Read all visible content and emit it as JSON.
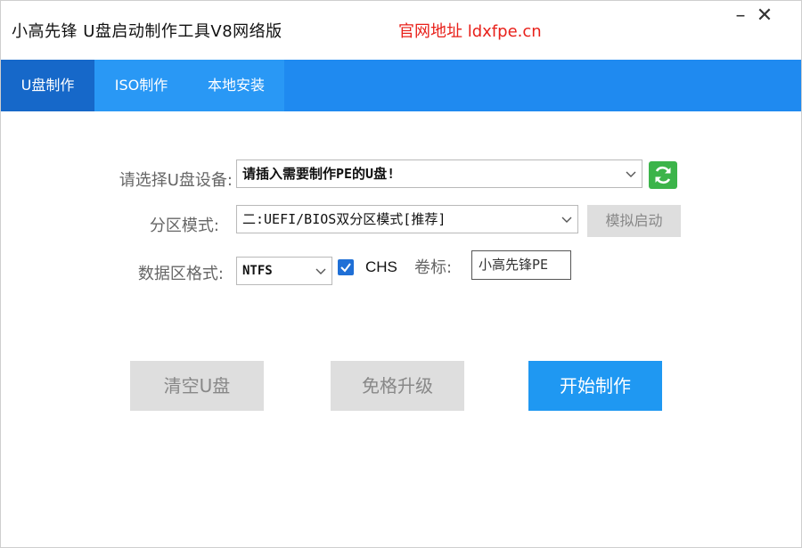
{
  "window": {
    "title": "小高先锋 U盘启动制作工具V8网络版",
    "website": "官网地址 ldxfpe.cn",
    "minimize_label": "–",
    "close_label": "✕"
  },
  "tabs": [
    {
      "label": "U盘制作",
      "active": true
    },
    {
      "label": "ISO制作",
      "active": false
    },
    {
      "label": "本地安装",
      "active": false
    }
  ],
  "form": {
    "device_label": "请选择U盘设备:",
    "device_value": "请插入需要制作PE的U盘!",
    "partition_label": "分区模式:",
    "partition_value": "二:UEFI/BIOS双分区模式[推荐]",
    "simulate_button": "模拟启动",
    "format_label": "数据区格式:",
    "format_value": "NTFS",
    "chs_label": "CHS",
    "chs_checked": true,
    "volume_label": "卷标:",
    "volume_value": "小高先锋PE"
  },
  "actions": {
    "clear": "清空U盘",
    "upgrade": "免格升级",
    "start": "开始制作"
  },
  "colors": {
    "accent": "#1f8af0",
    "active_tab": "#1668c9",
    "website_red": "#e8201a",
    "refresh_green": "#3cb44a",
    "start_button": "#1f98f2"
  },
  "icons": {
    "refresh": "refresh-icon",
    "dropdown": "chevron-down-icon",
    "checkbox": "check-icon"
  }
}
